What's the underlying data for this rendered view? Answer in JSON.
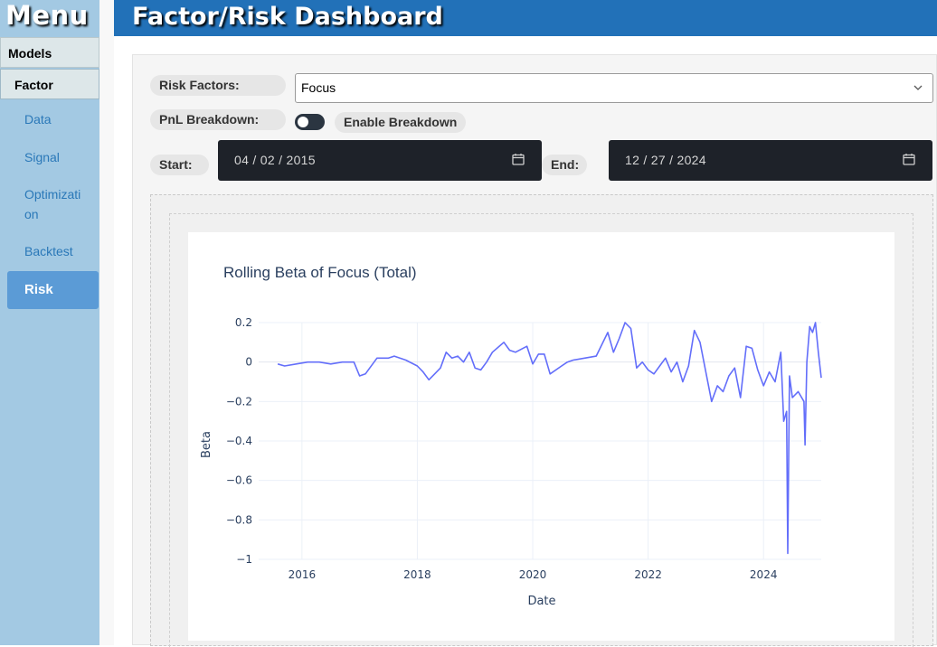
{
  "sidebar": {
    "title": "Menu",
    "section": "Models",
    "group": "Factor",
    "items": [
      {
        "label": "Data"
      },
      {
        "label": "Signal"
      },
      {
        "label": "Optimization"
      },
      {
        "label": "Backtest"
      },
      {
        "label": "Risk",
        "active": true
      }
    ]
  },
  "header": {
    "title": "Factor/Risk Dashboard",
    "color": "#2271b8"
  },
  "controls": {
    "risk_factors_label": "Risk Factors:",
    "risk_factor_value": "Focus",
    "pnl_label": "PnL Breakdown:",
    "enable_label": "Enable Breakdown",
    "enable_on": false,
    "start_label": "Start:",
    "start_value": "04 / 02 / 2015",
    "end_label": "End:",
    "end_value": "12 / 27 / 2024"
  },
  "icons": {
    "select": "chevron-down-icon",
    "date": "calendar-icon"
  },
  "chart_data": {
    "type": "line",
    "title": "Rolling Beta of Focus (Total)",
    "xlabel": "Date",
    "ylabel": "Beta",
    "xlim": [
      2015.25,
      2025.0
    ],
    "ylim": [
      -1.0,
      0.2
    ],
    "xticks": [
      2016,
      2018,
      2020,
      2022,
      2024
    ],
    "xtick_labels": [
      "2016",
      "2018",
      "2020",
      "2022",
      "2024"
    ],
    "yticks": [
      0.2,
      0,
      -0.2,
      -0.4,
      -0.6,
      -0.8,
      -1
    ],
    "ytick_labels": [
      "0.2",
      "0",
      "−0.2",
      "−0.4",
      "−0.6",
      "−0.8",
      "−1"
    ],
    "grid": true,
    "line_color": "#636efa",
    "series": [
      {
        "x": [
          2015.58,
          2015.7,
          2015.9,
          2016.1,
          2016.3,
          2016.5,
          2016.7,
          2016.9,
          2017.0,
          2017.1,
          2017.3,
          2017.5,
          2017.6,
          2017.8,
          2018.0,
          2018.1,
          2018.2,
          2018.3,
          2018.4,
          2018.5,
          2018.6,
          2018.7,
          2018.8,
          2018.9,
          2019.0,
          2019.1,
          2019.2,
          2019.3,
          2019.5,
          2019.6,
          2019.7,
          2019.9,
          2020.0,
          2020.1,
          2020.2,
          2020.3,
          2020.5,
          2020.6,
          2020.7,
          2020.9,
          2021.1,
          2021.3,
          2021.4,
          2021.5,
          2021.6,
          2021.7,
          2021.8,
          2021.9,
          2022.0,
          2022.1,
          2022.2,
          2022.3,
          2022.4,
          2022.5,
          2022.6,
          2022.7,
          2022.8,
          2022.9,
          2023.0,
          2023.1,
          2023.2,
          2023.3,
          2023.4,
          2023.5,
          2023.6,
          2023.7,
          2023.8,
          2023.9,
          2024.0,
          2024.1,
          2024.2,
          2024.3,
          2024.35,
          2024.4,
          2024.42,
          2024.45,
          2024.5,
          2024.6,
          2024.7,
          2024.72,
          2024.75,
          2024.8,
          2024.85,
          2024.9,
          2024.95,
          2025.0
        ],
        "y": [
          -0.01,
          -0.02,
          -0.01,
          0.0,
          0.0,
          -0.01,
          0.0,
          0.0,
          -0.07,
          -0.06,
          0.02,
          0.02,
          0.03,
          0.01,
          -0.02,
          -0.05,
          -0.09,
          -0.06,
          -0.03,
          0.05,
          0.02,
          0.03,
          0.0,
          0.05,
          -0.03,
          -0.04,
          0.0,
          0.05,
          0.1,
          0.06,
          0.05,
          0.08,
          -0.01,
          0.04,
          0.04,
          -0.06,
          -0.02,
          0.0,
          0.01,
          0.02,
          0.03,
          0.15,
          0.05,
          0.12,
          0.2,
          0.17,
          -0.03,
          0.0,
          -0.04,
          -0.06,
          -0.02,
          0.02,
          -0.05,
          0.0,
          -0.1,
          -0.02,
          0.16,
          0.1,
          -0.05,
          -0.2,
          -0.12,
          -0.15,
          -0.07,
          -0.03,
          -0.18,
          0.08,
          0.07,
          -0.04,
          -0.12,
          -0.05,
          -0.1,
          0.05,
          -0.3,
          -0.25,
          -0.97,
          -0.07,
          -0.18,
          -0.15,
          -0.2,
          -0.42,
          0.0,
          0.18,
          0.15,
          0.2,
          0.05,
          -0.08
        ]
      }
    ]
  }
}
